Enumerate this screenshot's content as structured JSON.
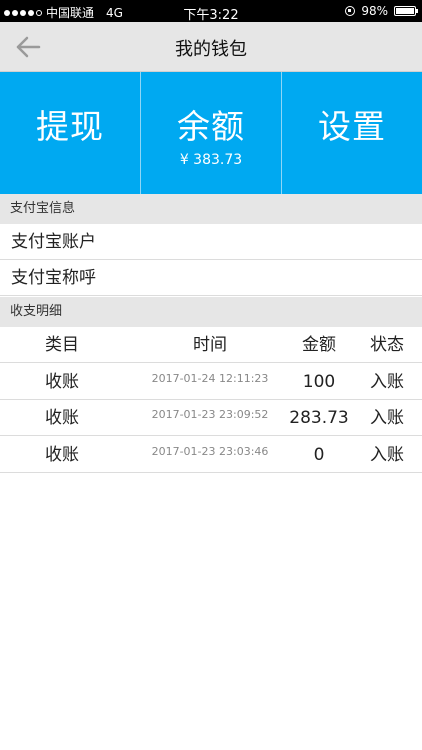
{
  "status_bar": {
    "carrier": "中国联通",
    "network": "4G",
    "time": "下午3:22",
    "battery": "98%"
  },
  "nav": {
    "title": "我的钱包",
    "back_icon": "back-arrow-icon"
  },
  "actions": {
    "withdraw": "提现",
    "balance": "余额",
    "balance_value": "¥ 383.73",
    "settings": "设置"
  },
  "alipay": {
    "header": "支付宝信息",
    "account": "支付宝账户",
    "nickname": "支付宝称呼"
  },
  "ledger": {
    "header": "收支明细",
    "columns": [
      "类目",
      "时间",
      "金额",
      "状态"
    ],
    "rows": [
      {
        "category": "收账",
        "time": "2017-01-24 12:11:23",
        "amount": "100",
        "status": "入账"
      },
      {
        "category": "收账",
        "time": "2017-01-23 23:09:52",
        "amount": "283.73",
        "status": "入账"
      },
      {
        "category": "收账",
        "time": "2017-01-23 23:03:46",
        "amount": "0",
        "status": "入账"
      }
    ]
  },
  "colors": {
    "accent": "#00a9f1",
    "nav_bg": "#e6e6e6"
  }
}
